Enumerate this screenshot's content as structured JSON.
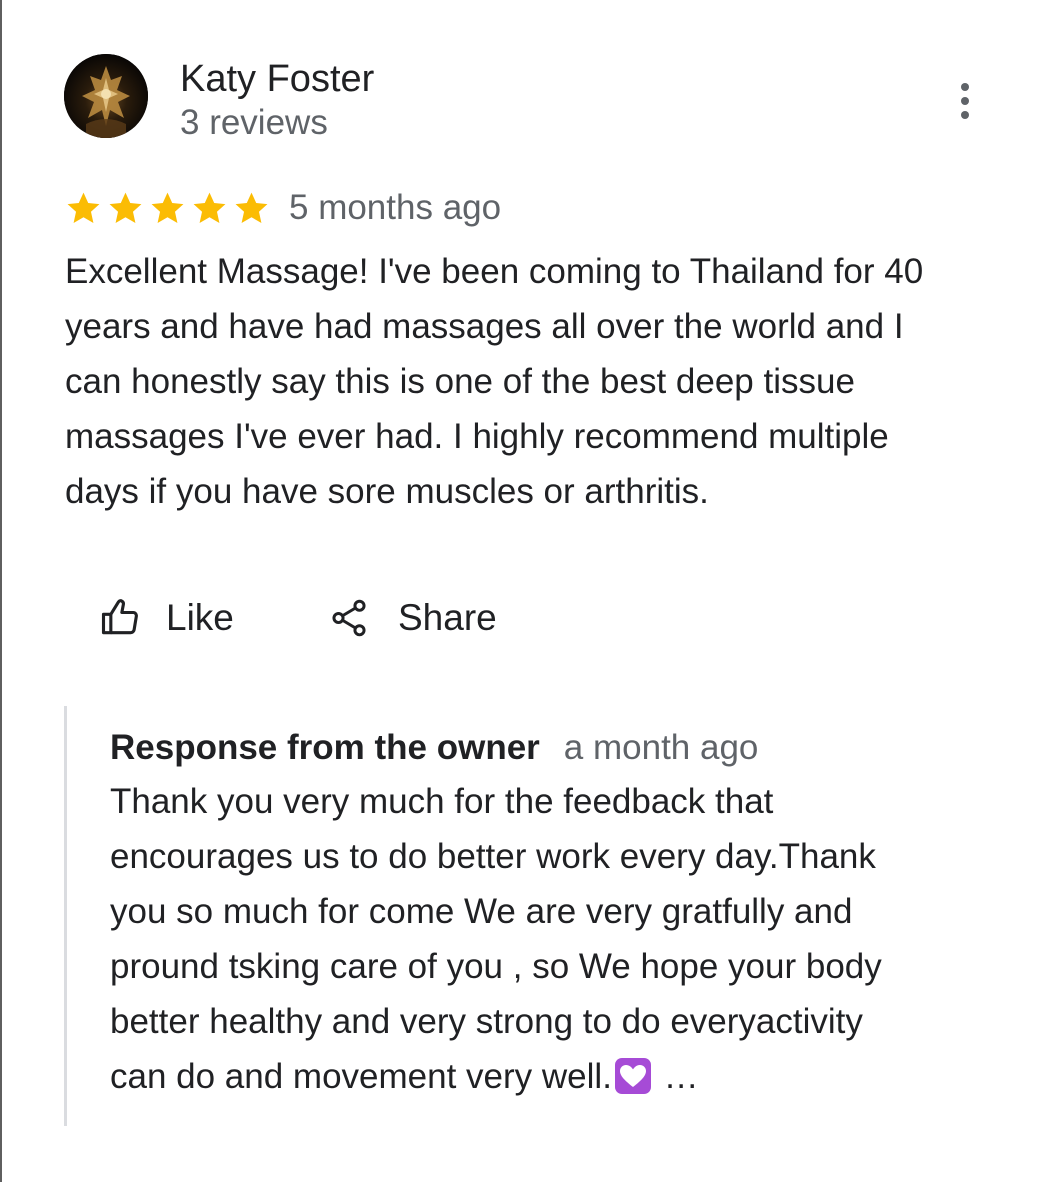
{
  "reviewer": {
    "name": "Katy Foster",
    "review_count": "3 reviews",
    "avatar_icon": "profile-photo"
  },
  "menu": {
    "icon": "more-vert-icon"
  },
  "review": {
    "rating": 5,
    "rating_max": 5,
    "star_color": "#fbbc04",
    "time": "5 months ago",
    "text_lines": [
      "Excellent Massage! I've been coming to Thailand for 40",
      "years and have had massages all over the world and I",
      "can honestly say this is one of the best deep tissue",
      "massages I've ever had. I highly recommend multiple",
      "days if you have sore muscles or arthritis."
    ]
  },
  "actions": {
    "like_label": "Like",
    "share_label": "Share"
  },
  "owner_response": {
    "title": "Response from the owner",
    "time": "a month ago",
    "text_lines": [
      "Thank you very much for the feedback that",
      "encourages us to do better work every day.Thank",
      "you so much for come We are very gratfully and",
      "pround tsking care of you , so We hope your body",
      "better healthy and very strong to do everyactivity"
    ],
    "last_line_text": "can do and movement very well.",
    "last_line_emoji": "heart-with-ribbon-emoji",
    "ellipsis": "…"
  }
}
